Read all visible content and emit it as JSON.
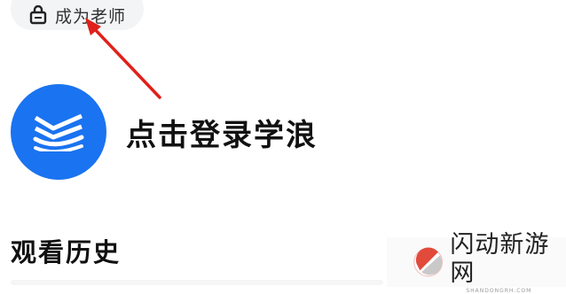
{
  "header": {
    "become_teacher_label": "成为老师",
    "become_teacher_icon": "teacher-bag-icon"
  },
  "profile": {
    "login_prompt": "点击登录学浪",
    "avatar_icon": "xuelang-logo-icon",
    "avatar_color": "#1a73f0"
  },
  "annotation": {
    "arrow_icon": "red-arrow-icon",
    "arrow_color": "#e0201b"
  },
  "sections": {
    "history_title": "观看历史"
  },
  "watermark": {
    "name": "闪动新游网",
    "domain": "SHANDONGRH.COM"
  }
}
